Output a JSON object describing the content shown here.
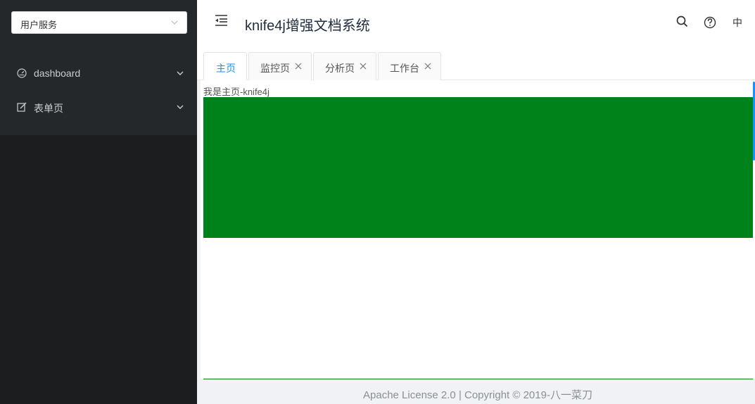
{
  "sidebar": {
    "service_select": {
      "value": "用户服务",
      "icon": "chevron-down-icon"
    },
    "items": [
      {
        "label": "dashboard",
        "icon": "dashboard-icon"
      },
      {
        "label": "表单页",
        "icon": "edit-icon"
      }
    ]
  },
  "header": {
    "title": "knife4j增强文档系统",
    "lang": "中",
    "icons": [
      "menu-fold-icon",
      "search-icon",
      "help-icon"
    ]
  },
  "tabs": [
    {
      "label": "主页",
      "active": true,
      "closable": false
    },
    {
      "label": "监控页",
      "active": false,
      "closable": true
    },
    {
      "label": "分析页",
      "active": false,
      "closable": true
    },
    {
      "label": "工作台",
      "active": false,
      "closable": true
    }
  ],
  "main": {
    "intro_text": "我是主页-knife4j"
  },
  "footer": {
    "text": "Apache License 2.0 | Copyright © 2019-八一菜刀"
  },
  "colors": {
    "sidebar_bg": "#1b1d1f",
    "green_block": "#00821a",
    "accent": "#1890ff"
  }
}
